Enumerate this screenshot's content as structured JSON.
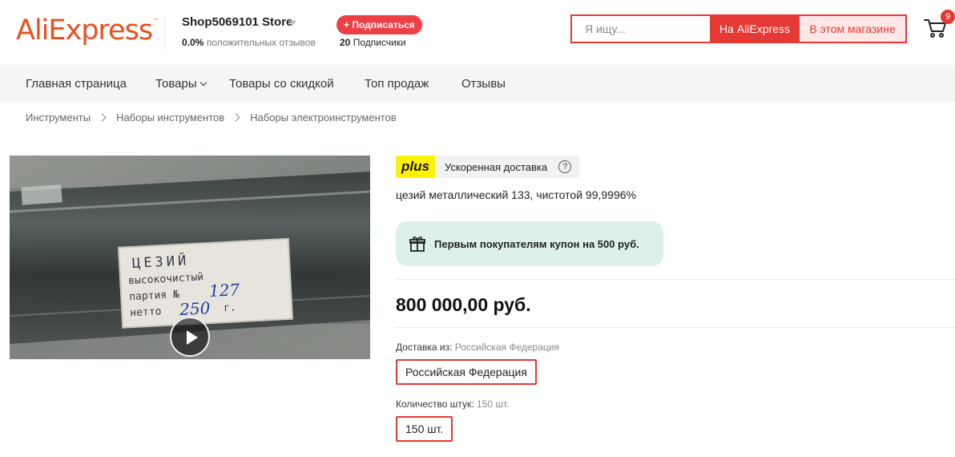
{
  "header": {
    "logo_text": "AliExpress",
    "logo_tm": "™",
    "store_name": "Shop5069101 Store",
    "store_rating_value": "0.0%",
    "store_rating_label": "положительных отзывов",
    "subscribe_label": "+ Подписаться",
    "followers_count": "20",
    "followers_label": "Подписчики",
    "search_placeholder": "Я ищу...",
    "search_aliexpress_label": "На AliExpress",
    "search_store_label": "В этом магазине",
    "cart_count": "9",
    "colors": {
      "brand": "#e8501e",
      "accent": "#e53935"
    }
  },
  "nav": {
    "items": [
      {
        "label": "Главная страница"
      },
      {
        "label": "Товары"
      },
      {
        "label": "Товары со скидкой"
      },
      {
        "label": "Топ продаж"
      },
      {
        "label": "Отзывы"
      }
    ]
  },
  "breadcrumb": [
    "Инструменты",
    "Наборы инструментов",
    "Наборы электроинструментов"
  ],
  "media": {
    "label_lines": [
      "ЦЕЗИЙ",
      "высокочистый",
      "партия №",
      "нетто",
      "г."
    ],
    "handwritten_batch": "127",
    "handwritten_weight": "250"
  },
  "product": {
    "plus_badge": "plus",
    "delivery_label": "Ускоренная доставка",
    "help_icon": "?",
    "title": "цезий металлический 133, чистотой 99,9996%",
    "coupon_text": "Первым покупателям купон на 500 руб.",
    "price": "800 000,00 руб.",
    "ship_from_label": "Доставка из:",
    "ship_from_value": "Российская Федерация",
    "ship_option": "Российская Федерация",
    "qty_label": "Количество штук:",
    "qty_value": "150 шт.",
    "qty_option": "150 шт."
  }
}
